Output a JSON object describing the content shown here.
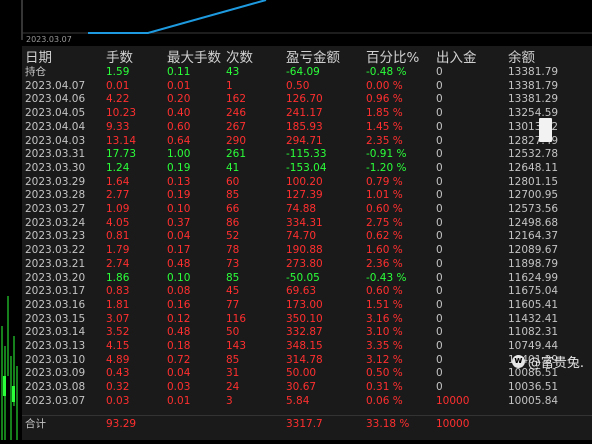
{
  "chart": {
    "date_label": "2023.03.07"
  },
  "table": {
    "headers": [
      "日期",
      "手数",
      "最大手数",
      "次数",
      "盈亏金额",
      "百分比%",
      "出入金",
      "余额"
    ],
    "rows": [
      {
        "date": "持仓",
        "lots": "1.59",
        "max_lots": "0.11",
        "count": "43",
        "pnl": "-64.09",
        "pct": "-0.48 %",
        "flow": "0",
        "balance": "13381.79",
        "tone": "green"
      },
      {
        "date": "2023.04.07",
        "lots": "0.01",
        "max_lots": "0.01",
        "count": "1",
        "pnl": "0.50",
        "pct": "0.00 %",
        "flow": "0",
        "balance": "13381.79",
        "tone": "red"
      },
      {
        "date": "2023.04.06",
        "lots": "4.22",
        "max_lots": "0.20",
        "count": "162",
        "pnl": "126.70",
        "pct": "0.96 %",
        "flow": "0",
        "balance": "13381.29",
        "tone": "red"
      },
      {
        "date": "2023.04.05",
        "lots": "10.23",
        "max_lots": "0.40",
        "count": "246",
        "pnl": "241.17",
        "pct": "1.85 %",
        "flow": "0",
        "balance": "13254.59",
        "tone": "red"
      },
      {
        "date": "2023.04.04",
        "lots": "9.33",
        "max_lots": "0.60",
        "count": "267",
        "pnl": "185.93",
        "pct": "1.45 %",
        "flow": "0",
        "balance": "13013.42",
        "tone": "red"
      },
      {
        "date": "2023.04.03",
        "lots": "13.14",
        "max_lots": "0.64",
        "count": "290",
        "pnl": "294.71",
        "pct": "2.35 %",
        "flow": "0",
        "balance": "12827.49",
        "tone": "red"
      },
      {
        "date": "2023.03.31",
        "lots": "17.73",
        "max_lots": "1.00",
        "count": "261",
        "pnl": "-115.33",
        "pct": "-0.91 %",
        "flow": "0",
        "balance": "12532.78",
        "tone": "green"
      },
      {
        "date": "2023.03.30",
        "lots": "1.24",
        "max_lots": "0.19",
        "count": "41",
        "pnl": "-153.04",
        "pct": "-1.20 %",
        "flow": "0",
        "balance": "12648.11",
        "tone": "green"
      },
      {
        "date": "2023.03.29",
        "lots": "1.64",
        "max_lots": "0.13",
        "count": "60",
        "pnl": "100.20",
        "pct": "0.79 %",
        "flow": "0",
        "balance": "12801.15",
        "tone": "red"
      },
      {
        "date": "2023.03.28",
        "lots": "2.77",
        "max_lots": "0.19",
        "count": "85",
        "pnl": "127.39",
        "pct": "1.01 %",
        "flow": "0",
        "balance": "12700.95",
        "tone": "red"
      },
      {
        "date": "2023.03.27",
        "lots": "1.09",
        "max_lots": "0.10",
        "count": "66",
        "pnl": "74.88",
        "pct": "0.60 %",
        "flow": "0",
        "balance": "12573.56",
        "tone": "red"
      },
      {
        "date": "2023.03.24",
        "lots": "4.05",
        "max_lots": "0.37",
        "count": "86",
        "pnl": "334.31",
        "pct": "2.75 %",
        "flow": "0",
        "balance": "12498.68",
        "tone": "red"
      },
      {
        "date": "2023.03.23",
        "lots": "0.81",
        "max_lots": "0.04",
        "count": "52",
        "pnl": "74.70",
        "pct": "0.62 %",
        "flow": "0",
        "balance": "12164.37",
        "tone": "red"
      },
      {
        "date": "2023.03.22",
        "lots": "1.79",
        "max_lots": "0.17",
        "count": "78",
        "pnl": "190.88",
        "pct": "1.60 %",
        "flow": "0",
        "balance": "12089.67",
        "tone": "red"
      },
      {
        "date": "2023.03.21",
        "lots": "2.74",
        "max_lots": "0.48",
        "count": "73",
        "pnl": "273.80",
        "pct": "2.36 %",
        "flow": "0",
        "balance": "11898.79",
        "tone": "red"
      },
      {
        "date": "2023.03.20",
        "lots": "1.86",
        "max_lots": "0.10",
        "count": "85",
        "pnl": "-50.05",
        "pct": "-0.43 %",
        "flow": "0",
        "balance": "11624.99",
        "tone": "green"
      },
      {
        "date": "2023.03.17",
        "lots": "0.83",
        "max_lots": "0.08",
        "count": "45",
        "pnl": "69.63",
        "pct": "0.60 %",
        "flow": "0",
        "balance": "11675.04",
        "tone": "red"
      },
      {
        "date": "2023.03.16",
        "lots": "1.81",
        "max_lots": "0.16",
        "count": "77",
        "pnl": "173.00",
        "pct": "1.51 %",
        "flow": "0",
        "balance": "11605.41",
        "tone": "red"
      },
      {
        "date": "2023.03.15",
        "lots": "3.07",
        "max_lots": "0.12",
        "count": "116",
        "pnl": "350.10",
        "pct": "3.16 %",
        "flow": "0",
        "balance": "11432.41",
        "tone": "red"
      },
      {
        "date": "2023.03.14",
        "lots": "3.52",
        "max_lots": "0.48",
        "count": "50",
        "pnl": "332.87",
        "pct": "3.10 %",
        "flow": "0",
        "balance": "11082.31",
        "tone": "red"
      },
      {
        "date": "2023.03.13",
        "lots": "4.15",
        "max_lots": "0.18",
        "count": "143",
        "pnl": "348.15",
        "pct": "3.35 %",
        "flow": "0",
        "balance": "10749.44",
        "tone": "red"
      },
      {
        "date": "2023.03.10",
        "lots": "4.89",
        "max_lots": "0.72",
        "count": "85",
        "pnl": "314.78",
        "pct": "3.12 %",
        "flow": "0",
        "balance": "10401.29",
        "tone": "red"
      },
      {
        "date": "2023.03.09",
        "lots": "0.43",
        "max_lots": "0.04",
        "count": "31",
        "pnl": "50.00",
        "pct": "0.50 %",
        "flow": "0",
        "balance": "10086.51",
        "tone": "red"
      },
      {
        "date": "2023.03.08",
        "lots": "0.32",
        "max_lots": "0.03",
        "count": "24",
        "pnl": "30.67",
        "pct": "0.31 %",
        "flow": "0",
        "balance": "10036.51",
        "tone": "red"
      },
      {
        "date": "2023.03.07",
        "lots": "0.03",
        "max_lots": "0.01",
        "count": "3",
        "pnl": "5.84",
        "pct": "0.06 %",
        "flow": "10000",
        "balance": "10005.84",
        "tone": "red"
      }
    ],
    "total": {
      "date": "合计",
      "lots": "93.29",
      "max_lots": "",
      "count": "",
      "pnl": "3317.7",
      "pct": "33.18 %",
      "flow": "10000",
      "balance": "",
      "tone": "red"
    }
  },
  "watermark": {
    "icon": "weibo-logo-icon",
    "text": "@富贵兔."
  },
  "colors": {
    "positive": "#ff2f2f",
    "negative": "#2bff3a",
    "line": "#1e9be0",
    "candle": "#2bff3a"
  }
}
